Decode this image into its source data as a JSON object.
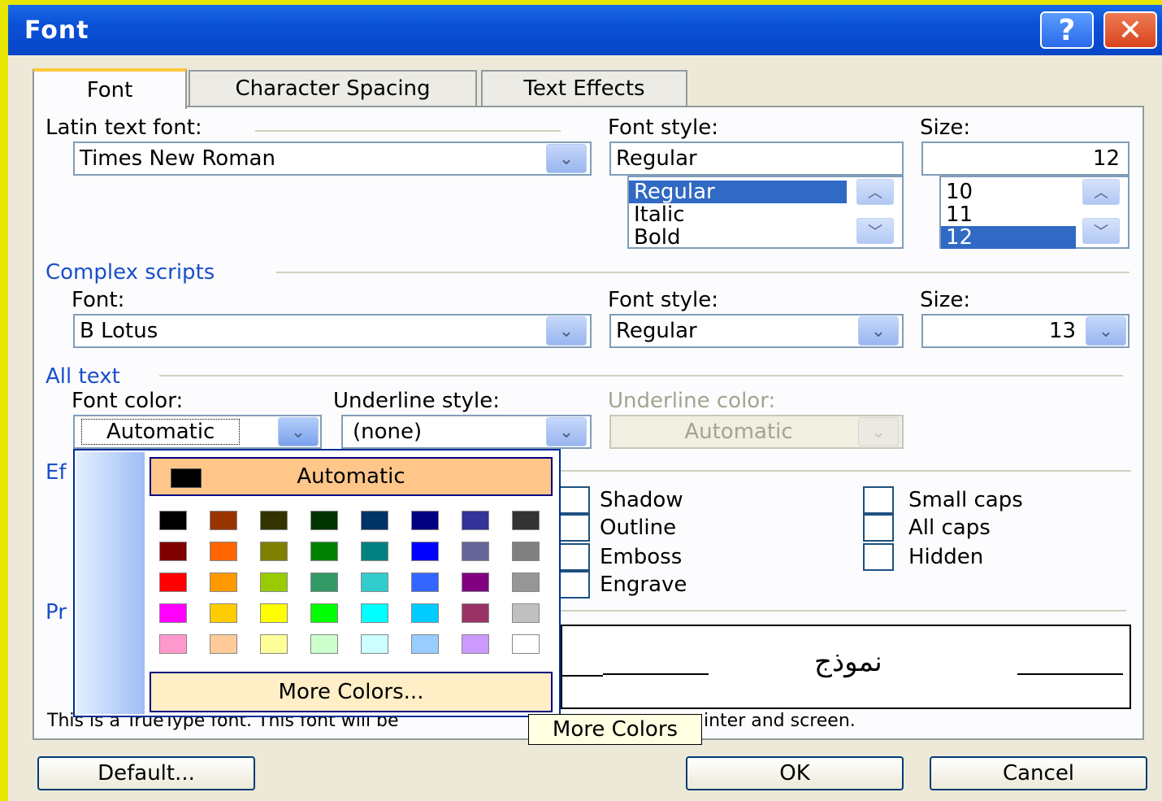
{
  "window": {
    "title": "Font"
  },
  "title_buttons": {
    "help": "?",
    "close": "✕"
  },
  "tabs": [
    {
      "label": "Font",
      "active": true
    },
    {
      "label": "Character Spacing",
      "active": false
    },
    {
      "label": "Text Effects",
      "active": false
    }
  ],
  "latin": {
    "font_label": "Latin text font:",
    "font_value": "Times New Roman",
    "style_label": "Font style:",
    "style_value": "Regular",
    "style_options": [
      "Regular",
      "Italic",
      "Bold"
    ],
    "style_selected": "Regular",
    "size_label": "Size:",
    "size_value": "12",
    "size_options": [
      "10",
      "11",
      "12"
    ],
    "size_selected": "12"
  },
  "complex": {
    "section_label": "Complex scripts",
    "font_label": "Font:",
    "font_value": "B Lotus",
    "style_label": "Font style:",
    "style_value": "Regular",
    "size_label": "Size:",
    "size_value": "13"
  },
  "alltext": {
    "section_label": "All text",
    "font_color_label": "Font color:",
    "font_color_value": "Automatic",
    "underline_style_label": "Underline style:",
    "underline_style_value": "(none)",
    "underline_color_label": "Underline color:",
    "underline_color_value": "Automatic"
  },
  "effects": {
    "section_label_partial": "Ef",
    "items": [
      {
        "label": "Shadow",
        "checked": false
      },
      {
        "label": "Outline",
        "checked": false
      },
      {
        "label": "Emboss",
        "checked": false
      },
      {
        "label": "Engrave",
        "checked": false
      },
      {
        "label": "Small caps",
        "checked": false
      },
      {
        "label": "All caps",
        "checked": false
      },
      {
        "label": "Hidden",
        "checked": false
      }
    ]
  },
  "preview": {
    "section_label_partial": "Pr",
    "sample_text": "نموذج",
    "info_left": "This is a TrueType font. This font will be",
    "info_right": "inter and screen."
  },
  "color_popup": {
    "automatic_label": "Automatic",
    "more_colors_label": "More Colors...",
    "tooltip": "More Colors",
    "palette": [
      [
        "#000000",
        "#993300",
        "#333300",
        "#003300",
        "#003366",
        "#000080",
        "#333399",
        "#333333"
      ],
      [
        "#800000",
        "#ff6600",
        "#808000",
        "#008000",
        "#008080",
        "#0000ff",
        "#666699",
        "#808080"
      ],
      [
        "#ff0000",
        "#ff9900",
        "#99cc00",
        "#339966",
        "#33cccc",
        "#3366ff",
        "#800080",
        "#969696"
      ],
      [
        "#ff00ff",
        "#ffcc00",
        "#ffff00",
        "#00ff00",
        "#00ffff",
        "#00ccff",
        "#993366",
        "#c0c0c0"
      ],
      [
        "#ff99cc",
        "#ffcc99",
        "#ffff99",
        "#ccffcc",
        "#ccffff",
        "#99ccff",
        "#cc99ff",
        "#ffffff"
      ]
    ]
  },
  "buttons": {
    "default": "Default...",
    "ok": "OK",
    "cancel": "Cancel"
  }
}
